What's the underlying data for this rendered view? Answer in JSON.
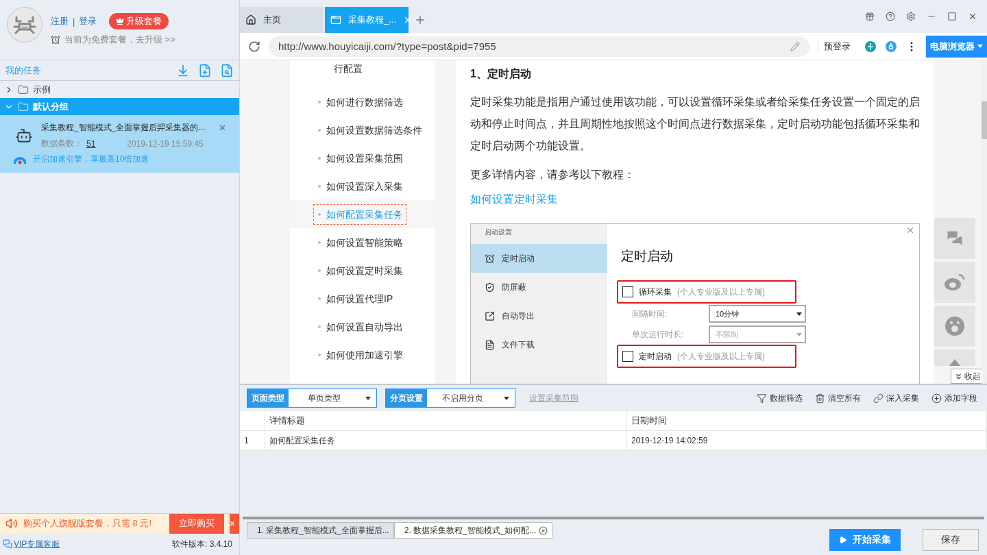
{
  "user": {
    "links": [
      "注册",
      "登录"
    ],
    "link_separator": "|",
    "upgrade_button": "升级套餐",
    "plan_note": "当前为免费套餐，去升级 >>"
  },
  "tasks": {
    "title": "我的任务",
    "groups": [
      {
        "name": "示例",
        "expanded": false,
        "selected": false
      },
      {
        "name": "默认分组",
        "expanded": true,
        "selected": true,
        "children": [
          {
            "title": "采集教程_智能模式_全面掌握后羿采集器的...",
            "count_label": "数据条数：",
            "count": "51",
            "time": "2019-12-19 15:59:45",
            "accelerate": "开启加速引擎，享最高10倍加速"
          }
        ]
      }
    ]
  },
  "promo": {
    "text": "购买个人旗舰版套餐，只需 8 元!",
    "button": "立即购买",
    "close": "×"
  },
  "footer": {
    "vip_link": "VIP专属客服",
    "version": "软件版本: 3.4.10"
  },
  "browser_tabs": [
    {
      "label": "主页",
      "kind": "home",
      "selected": false
    },
    {
      "label": "采集教程_...",
      "kind": "page",
      "selected": true
    }
  ],
  "address": {
    "url": "http://www.houyicaiji.com/?type=post&pid=7955",
    "prelogin": "预登录",
    "mode_button": "电脑浏览器"
  },
  "article_nav": [
    {
      "label": "行配置",
      "selected": false
    },
    {
      "label": "如何进行数据筛选",
      "selected": false
    },
    {
      "label": "如何设置数据筛选条件",
      "selected": false
    },
    {
      "label": "如何设置采集范围",
      "selected": false
    },
    {
      "label": "如何设置深入采集",
      "selected": false
    },
    {
      "label": "如何配置采集任务",
      "selected": true
    },
    {
      "label": "如何设置智能策略",
      "selected": false
    },
    {
      "label": "如何设置定时采集",
      "selected": false
    },
    {
      "label": "如何设置代理IP",
      "selected": false
    },
    {
      "label": "如何设置自动导出",
      "selected": false
    },
    {
      "label": "如何使用加速引擎",
      "selected": false
    }
  ],
  "article": {
    "heading": "1、定时启动",
    "paragraphs": [
      "定时采集功能是指用户通过使用该功能，可以设置循环采集或者给采集任务设置一个固定的启动和停止时间点，并且周期性地按照这个时间点进行数据采集，定时启动功能包括循环采集和定时启动两个功能设置。",
      "更多详情内容，请参考以下教程："
    ],
    "link": "如何设置定时采集",
    "figure": {
      "title": "启动设置",
      "menu": [
        {
          "label": "定时启动",
          "kind": "alarm",
          "selected": true
        },
        {
          "label": "防屏蔽",
          "kind": "shield",
          "selected": false
        },
        {
          "label": "自动导出",
          "kind": "export",
          "selected": false
        },
        {
          "label": "文件下载",
          "kind": "file",
          "selected": false
        }
      ],
      "heading": "定时启动",
      "rows": [
        {
          "kind": "checkbox",
          "label": "循环采集",
          "note": "(个人专业版及以上专属)",
          "checked": false,
          "highlighted": true
        },
        {
          "kind": "select",
          "label": "间隔时间:",
          "value": "10分钟",
          "disabled": false
        },
        {
          "kind": "select",
          "label": "单次运行时长:",
          "value": "不限制",
          "disabled": true
        },
        {
          "kind": "checkbox",
          "label": "定时启动",
          "note": "(个人专业版及以上专属)",
          "checked": false,
          "highlighted": true
        }
      ]
    }
  },
  "collapse_button": "收起",
  "collector": {
    "page_type": {
      "label": "页面类型",
      "value": "单页类型"
    },
    "paging": {
      "label": "分页设置",
      "value": "不启用分页"
    },
    "range_link": {
      "label": "设置采集范围",
      "disabled": true
    },
    "actions": [
      {
        "label": "数据筛选",
        "kind": "filter"
      },
      {
        "label": "清空所有",
        "kind": "trash"
      },
      {
        "label": "深入采集",
        "kind": "link"
      },
      {
        "label": "添加字段",
        "kind": "add"
      }
    ],
    "columns": [
      "详情标题",
      "日期时间"
    ],
    "rows": [
      {
        "index": "1",
        "cells": [
          "如何配置采集任务",
          "2019-12-19 14:02:59"
        ]
      }
    ]
  },
  "task_tabs": [
    {
      "label": "1. 采集教程_智能模式_全面掌握后...",
      "selected": false
    },
    {
      "label": "2. 数据采集教程_智能模式_如何配...",
      "selected": true
    }
  ],
  "start_button": "开始采集",
  "save_button": "保存"
}
